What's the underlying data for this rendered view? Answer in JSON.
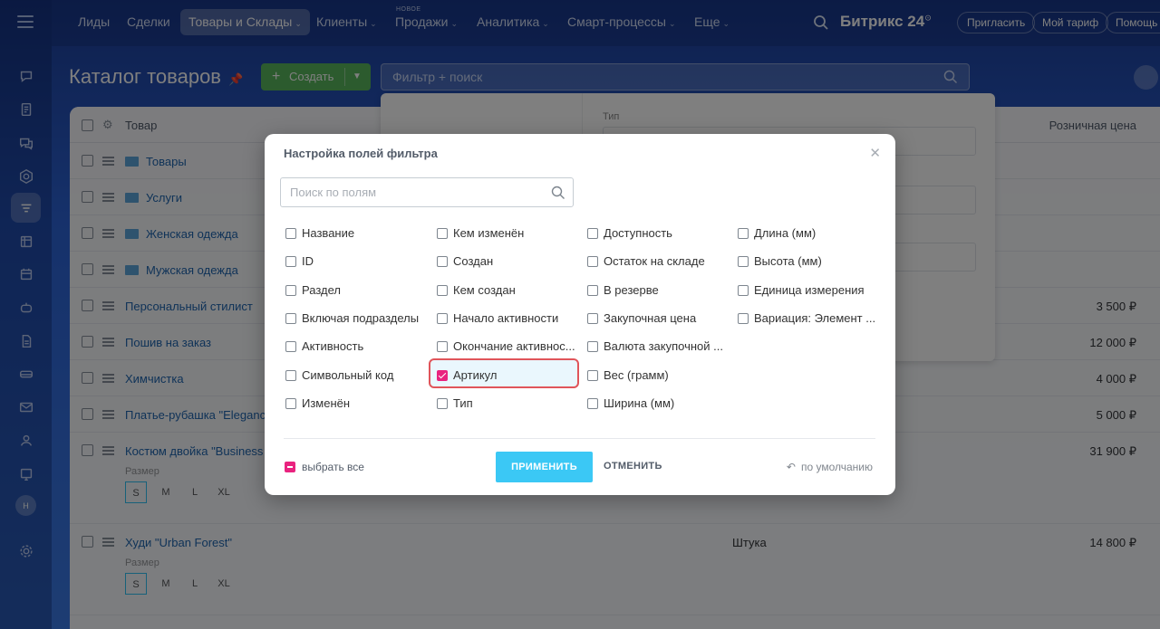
{
  "app": {
    "brand": "Битрикс 24",
    "brand_sup": "⊙"
  },
  "topnav": {
    "items": [
      {
        "label": "Лиды",
        "chevron": ""
      },
      {
        "label": "Сделки",
        "chevron": ""
      },
      {
        "label": "Товары и Склады",
        "chevron": "⌄"
      },
      {
        "label": "Клиенты",
        "chevron": "⌄"
      },
      {
        "label": "Продажи",
        "chevron": "⌄"
      },
      {
        "label": "Аналитика",
        "chevron": "⌄"
      },
      {
        "label": "Смарт-процессы",
        "chevron": "⌄"
      },
      {
        "label": "Еще",
        "chevron": "⌄"
      }
    ],
    "new_badge": "НОВОЕ",
    "invite": "Пригласить",
    "tariff": "Мой тариф",
    "help": "Помощь"
  },
  "user": {
    "initial": "Н"
  },
  "page": {
    "title": "Каталог товаров",
    "create_label": "Создать",
    "filter_placeholder": "Фильтр + поиск"
  },
  "grid": {
    "col_product": "Товар",
    "col_price": "Розничная цена",
    "rows": [
      {
        "name": "Товары",
        "price": ""
      },
      {
        "name": "Услуги",
        "price": ""
      },
      {
        "name": "Женская одежда",
        "price": ""
      },
      {
        "name": "Мужская одежда",
        "price": ""
      },
      {
        "name": "Персональный стилист",
        "price": "3 500 ₽"
      },
      {
        "name": "Пошив на заказ",
        "price": "12 000 ₽"
      },
      {
        "name": "Химчистка",
        "price": "4 000 ₽"
      },
      {
        "name": "Платье-рубашка \"Elegance",
        "price": "5 000 ₽"
      },
      {
        "name": "Костюм двойка \"Business",
        "price": "31 900 ₽"
      },
      {
        "name": "Худи \"Urban Forest\"",
        "price": "14 800 ₽"
      }
    ],
    "size_label": "Размер",
    "sizes": [
      "S",
      "M",
      "L",
      "XL"
    ],
    "unit": "Штука"
  },
  "under_panel": {
    "type_label": "Тип"
  },
  "modal": {
    "title": "Настройка полей фильтра",
    "search_placeholder": "Поиск по полям",
    "columns": [
      [
        {
          "label": "Название",
          "checked": false
        },
        {
          "label": "ID",
          "checked": false
        },
        {
          "label": "Раздел",
          "checked": false
        },
        {
          "label": "Включая подразделы",
          "checked": false
        },
        {
          "label": "Активность",
          "checked": false
        },
        {
          "label": "Символьный код",
          "checked": false
        },
        {
          "label": "Изменён",
          "checked": false
        }
      ],
      [
        {
          "label": "Кем изменён",
          "checked": false
        },
        {
          "label": "Создан",
          "checked": false
        },
        {
          "label": "Кем создан",
          "checked": false
        },
        {
          "label": "Начало активности",
          "checked": false
        },
        {
          "label": "Окончание активнос...",
          "checked": false
        },
        {
          "label": "Артикул",
          "checked": true
        },
        {
          "label": "Тип",
          "checked": false
        }
      ],
      [
        {
          "label": "Доступность",
          "checked": false
        },
        {
          "label": "Остаток на складе",
          "checked": false
        },
        {
          "label": "В резерве",
          "checked": false
        },
        {
          "label": "Закупочная цена",
          "checked": false
        },
        {
          "label": "Валюта закупочной ...",
          "checked": false
        },
        {
          "label": "Вес (грамм)",
          "checked": false
        },
        {
          "label": "Ширина (мм)",
          "checked": false
        }
      ],
      [
        {
          "label": "Длина (мм)",
          "checked": false
        },
        {
          "label": "Высота (мм)",
          "checked": false
        },
        {
          "label": "Единица измерения",
          "checked": false
        },
        {
          "label": "Вариация: Элемент ...",
          "checked": false
        }
      ]
    ],
    "select_all": "выбрать все",
    "apply": "ПРИМЕНИТЬ",
    "cancel": "ОТМЕНИТЬ",
    "reset": "по умолчанию"
  },
  "colors": {
    "accent": "#3bc8f5",
    "checked": "#e9237f",
    "create": "#59b65c",
    "highlight": "#e0555a"
  }
}
